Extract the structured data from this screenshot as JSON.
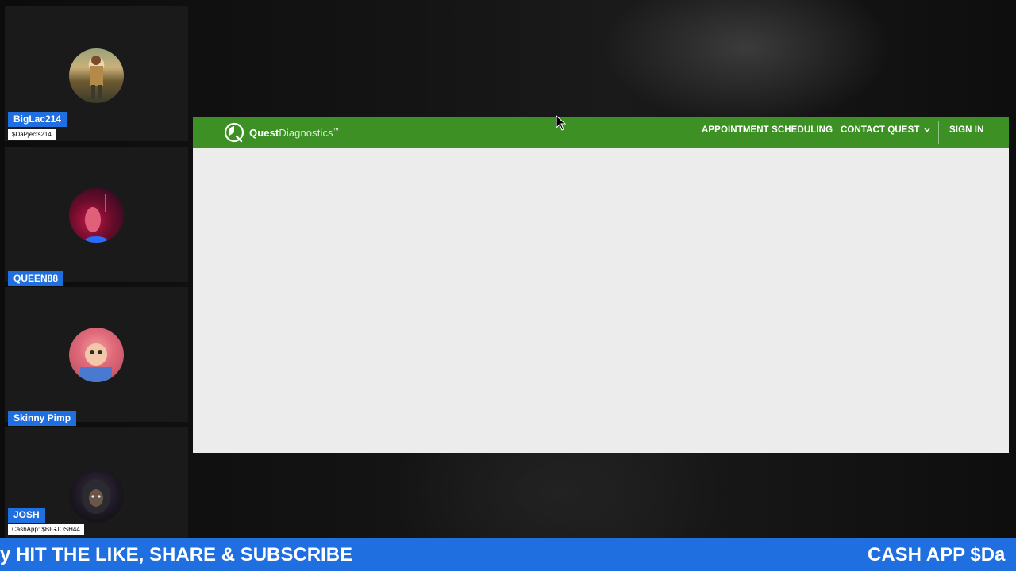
{
  "participants": [
    {
      "name": "BigLac214",
      "subtitle": "$DaPjects214",
      "avatar_icon": "avatar-camo-person"
    },
    {
      "name": "QUEEN88",
      "subtitle": "",
      "avatar_icon": "avatar-red-neon"
    },
    {
      "name": "Skinny Pimp",
      "subtitle": "",
      "avatar_icon": "avatar-doll"
    },
    {
      "name": "JOSH",
      "subtitle": "CashApp: $BIGJOSH44",
      "avatar_icon": "avatar-hooded-figure"
    }
  ],
  "shared_screen": {
    "brand": "Quest",
    "brand_suffix": "Diagnostics",
    "brand_mark": "™",
    "nav": {
      "appointment": "APPOINTMENT SCHEDULING",
      "contact": "CONTACT QUEST",
      "sign_in": "SIGN IN"
    },
    "brand_color": "#3d9024"
  },
  "ticker": {
    "left_text": "y HIT THE LIKE, SHARE & SUBSCRIBE",
    "right_text": "CASH APP $Da"
  },
  "colors": {
    "tag_blue": "#1f6fe0"
  }
}
